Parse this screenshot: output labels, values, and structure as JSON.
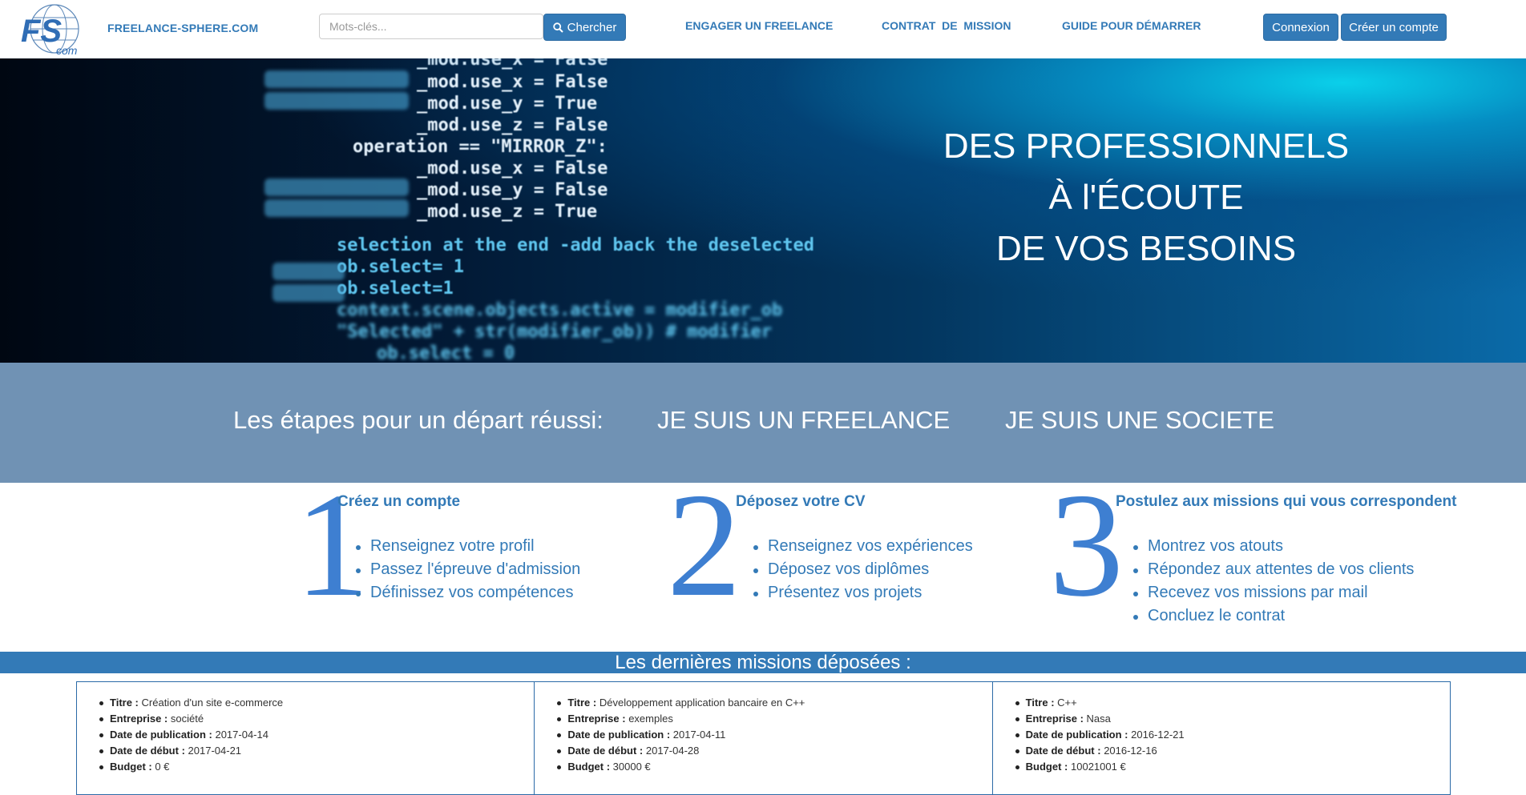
{
  "navbar": {
    "logo_text": "FS com",
    "brand": "FREELANCE-SPHERE.COM",
    "search": {
      "placeholder": "Mots-clés...",
      "value": "",
      "button_label": "Chercher",
      "button_icon": "search-icon"
    },
    "links": [
      "ENGAGER UN FREELANCE",
      "CONTRAT  DE  MISSION",
      "GUIDE POUR DÉMARRER"
    ],
    "login_label": "Connexion",
    "signup_label": "Créer un compte"
  },
  "hero": {
    "lines": [
      "DES PROFESSIONNELS",
      "À l'ÉCOUTE",
      "DE VOS BESOINS"
    ],
    "code_lines": [
      "_mod.use_x = False",
      "_mod.use_y = True",
      "_mod.use_z = False",
      "operation == \"MIRROR_Z\":",
      "_mod.use_x = False",
      "_mod.use_y = False",
      "_mod.use_z = True",
      "selection at the end -add back the deselected",
      "ob.select= 1",
      "ob.select=1",
      "context.scene.objects.active = modifier_ob",
      "\"Selected\" + str(modifier_ob)) # modifier",
      "ob.select = 0"
    ]
  },
  "steps_band": {
    "title": "Les étapes pour un départ réussi:",
    "freelance_label": "JE SUIS UN FREELANCE",
    "company_label": "JE SUIS UNE SOCIETE"
  },
  "steps": [
    {
      "number": "1",
      "title": "Créez un compte",
      "items": [
        "Renseignez votre profil",
        "Passez l'épreuve d'admission",
        "Définissez vos compétences"
      ]
    },
    {
      "number": "2",
      "title": "Déposez votre CV",
      "items": [
        "Renseignez vos expériences",
        "Déposez vos diplômes",
        "Présentez vos projets"
      ]
    },
    {
      "number": "3",
      "title": "Postulez aux missions qui vous correspondent",
      "items": [
        "Montrez vos atouts",
        "Répondez aux attentes de vos clients",
        "Recevez vos missions par mail",
        "Concluez le contrat"
      ]
    }
  ],
  "missions": {
    "heading": "Les dernières missions déposées :",
    "labels": {
      "title": "Titre :",
      "company": "Entreprise :",
      "published": "Date de publication :",
      "start": "Date de début :",
      "budget": "Budget :"
    },
    "cards": [
      {
        "title": "Création d'un site e-commerce",
        "company": "société",
        "published": "2017-04-14",
        "start": "2017-04-21",
        "budget": "0 €"
      },
      {
        "title": "Développement application bancaire en C++",
        "company": "exemples",
        "published": "2017-04-11",
        "start": "2017-04-28",
        "budget": "30000 €"
      },
      {
        "title": "C++",
        "company": "Nasa",
        "published": "2016-12-21",
        "start": "2016-12-16",
        "budget": "10021001 €"
      }
    ]
  },
  "colors": {
    "primary": "#337ab7",
    "band": "#7092b4",
    "step_number": "#3e7fd1"
  }
}
